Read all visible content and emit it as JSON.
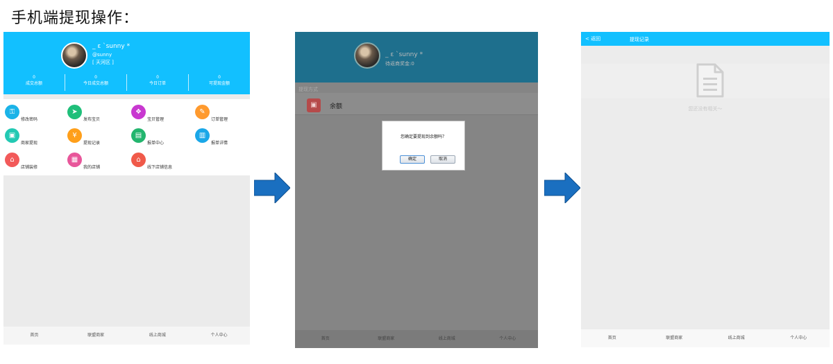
{
  "heading": "手机端提现操作：",
  "screen1": {
    "user": {
      "name": "_ ε `sunny *",
      "handle": "@sunny",
      "region": "[ 天河区 ]"
    },
    "stats": [
      {
        "value": "0",
        "label": "成交总额"
      },
      {
        "value": "0",
        "label": "今日成交总额"
      },
      {
        "value": "0",
        "label": "今日订单"
      },
      {
        "value": "0",
        "label": "可提现金额"
      }
    ],
    "menu": [
      {
        "label": "修改密码",
        "icon": "key-icon",
        "color": "#1ab3e8",
        "glyph": "⚿"
      },
      {
        "label": "发布宝贝",
        "icon": "send-icon",
        "color": "#1fbf7a",
        "glyph": "➤"
      },
      {
        "label": "宝贝管理",
        "icon": "gift-icon",
        "color": "#c838d0",
        "glyph": "❖"
      },
      {
        "label": "订单管理",
        "icon": "order-icon",
        "color": "#ff9a2e",
        "glyph": "✎"
      },
      {
        "label": "商家提现",
        "icon": "withdraw-icon",
        "color": "#22c9b3",
        "glyph": "▣"
      },
      {
        "label": "提现记录",
        "icon": "record-icon",
        "color": "#ff9f1a",
        "glyph": "¥"
      },
      {
        "label": "报单中心",
        "icon": "report-center-icon",
        "color": "#23b56e",
        "glyph": "▤"
      },
      {
        "label": "报单详情",
        "icon": "report-detail-icon",
        "color": "#1aa7e8",
        "glyph": "▥"
      },
      {
        "label": "店铺装修",
        "icon": "shop-decor-icon",
        "color": "#f25a5a",
        "glyph": "⌂"
      },
      {
        "label": "我的店铺",
        "icon": "my-shop-icon",
        "color": "#e8569a",
        "glyph": "▦"
      },
      {
        "label": "线下店铺信息",
        "icon": "offline-shop-icon",
        "color": "#f05a4a",
        "glyph": "⌂"
      }
    ],
    "nav": [
      "首页",
      "联盟商家",
      "线上商城",
      "个人中心"
    ]
  },
  "screen2": {
    "user": {
      "name": "_ ε `sunny *",
      "subtext": "待返商奖金:0"
    },
    "section_label": "提现方式",
    "row_label": "余额",
    "dialog": {
      "message": "您确定要提现到余额吗？",
      "ok": "确定",
      "cancel": "取消"
    },
    "nav": [
      "首页",
      "联盟商家",
      "线上商城",
      "个人中心"
    ]
  },
  "screen3": {
    "back": "<  返回",
    "title": "提现记录",
    "empty_text": "您还没有相关～",
    "nav": [
      "首页",
      "联盟商家",
      "线上商城",
      "个人中心"
    ]
  },
  "colors": {
    "brand": "#12c0ff",
    "arrow": "#1a6fc0"
  }
}
